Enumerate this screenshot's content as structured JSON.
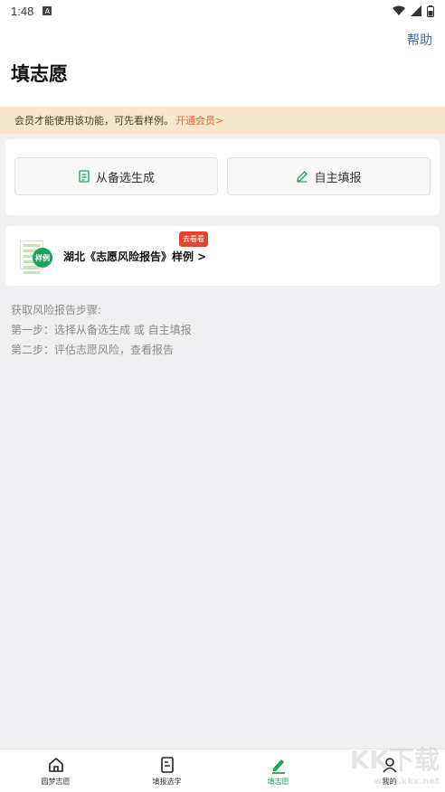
{
  "status": {
    "time": "1:48",
    "notif": "A"
  },
  "header": {
    "help": "帮助",
    "title": "填志愿"
  },
  "vip_banner": {
    "text": "会员才能使用该功能，可先看样例。",
    "link": "开通会员>"
  },
  "actions": {
    "generate": "从备选生成",
    "manual": "自主填报"
  },
  "sample": {
    "badge": "样例",
    "text": "湖北《志愿风险报告》样例 >",
    "tag": "去看看"
  },
  "steps": {
    "title": "获取风险报告步骤:",
    "step1": "第一步：选择从备选生成 或 自主填报",
    "step2": "第二步：评估志愿风险，查看报告"
  },
  "tabs": [
    {
      "label": "圆梦志愿",
      "icon": "home-icon"
    },
    {
      "label": "填报选学",
      "icon": "document-icon"
    },
    {
      "label": "填志愿",
      "icon": "pencil-icon",
      "active": true
    },
    {
      "label": "我的",
      "icon": "user-icon"
    }
  ],
  "watermark": {
    "main": "KK下载",
    "sub": "www.kkx.net"
  },
  "colors": {
    "accent": "#1aa35a",
    "banner": "#f6e7cc",
    "link_orange": "#e36a2e",
    "tag_red": "#e2462f"
  }
}
